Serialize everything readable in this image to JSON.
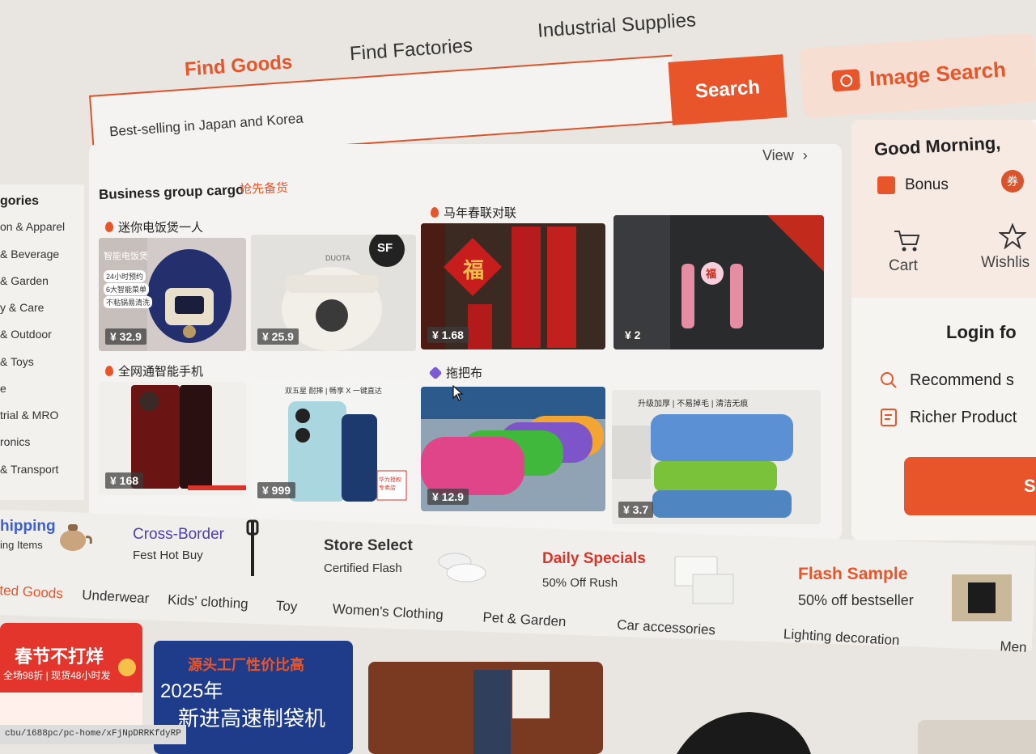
{
  "nav": {
    "tabs": [
      "Find Goods",
      "Find Factories",
      "Industrial Supplies"
    ],
    "active_index": 0
  },
  "search": {
    "value": "Best-selling in Japan and Korea",
    "button_label": "Search",
    "image_search_label": "Image Search"
  },
  "left_categories": {
    "title": "gories",
    "items": [
      "on & Apparel",
      "& Beverage",
      "& Garden",
      "y & Care",
      "& Outdoor",
      "& Toys",
      "e",
      "trial & MRO",
      "ronics",
      "& Transport"
    ]
  },
  "business_group": {
    "title": "Business group cargo",
    "subtitle": "抢先备货",
    "view_label": "View",
    "sections": [
      {
        "title": "迷你电饭煲一人",
        "icon": "fire-icon",
        "items": [
          {
            "price": "¥ 32.9",
            "label": "智能电饭煲",
            "tags": [
              "24小时预约",
              "6大智能菜单",
              "不粘锅易清洗"
            ]
          },
          {
            "price": "¥ 25.9",
            "label": "DUOTA",
            "badge": "SF"
          }
        ]
      },
      {
        "title": "马年春联对联",
        "icon": "fire-icon",
        "items": [
          {
            "price": "¥ 1.68",
            "label": "福"
          },
          {
            "price": "¥ 2",
            "label": "福"
          }
        ]
      },
      {
        "title": "全网通智能手机",
        "icon": "fire-icon",
        "items": [
          {
            "price": "¥ 168"
          },
          {
            "price": "¥ 999",
            "label": "双五星  耐摔 | 畅享 X 一键直达",
            "badge": "华为授权专卖店"
          }
        ]
      },
      {
        "title": "拖把布",
        "icon": "purple-badge-icon",
        "items": [
          {
            "price": "¥ 12.9"
          },
          {
            "price": "¥ 3.7",
            "label": "升级加厚 | 不易掉毛 | 清洁无痕"
          }
        ]
      }
    ]
  },
  "right_panel": {
    "greeting": "Good Morning,",
    "bonus_label": "Bonus",
    "coupon_icon": "券",
    "cart_label": "Cart",
    "wishlist_label": "Wishlis",
    "login_title": "Login fo",
    "benefits": [
      "Recommend s",
      "Richer Product"
    ],
    "login_button": "S"
  },
  "promo_strip": [
    {
      "title": "hipping",
      "subtitle": "ing Items",
      "color": "#3c5fd0"
    },
    {
      "title": "Cross-Border",
      "subtitle": "Fest Hot Buy",
      "color": "#4f3fb0"
    },
    {
      "title": "Store Select",
      "subtitle": "Certified Flash",
      "color": "#333333"
    },
    {
      "title": "Daily Specials",
      "subtitle": "50% Off Rush",
      "color": "#d9342a"
    },
    {
      "title": "Flash Sample",
      "subtitle": "50% off bestseller",
      "color": "#e8552a"
    }
  ],
  "category_tabs": [
    "ted Goods",
    "Underwear",
    "Kids' clothing",
    "Toy",
    "Women's Clothing",
    "Pet & Garden",
    "Car accessories",
    "Lighting decoration",
    "Men"
  ],
  "bottom_cards": [
    {
      "title": "春节不打烊",
      "subtitle": "全场98折 | 现货48小时发"
    },
    {
      "title": "源头工厂性价比高",
      "subtitle": "2025年",
      "line2": "新进高速制袋机"
    }
  ],
  "status_url": "cbu/1688pc/pc-home/xFjNpDRRKfdyRP",
  "colors": {
    "accent": "#e8552a",
    "panel": "#f5f3f1",
    "page": "#e9e6e2"
  }
}
